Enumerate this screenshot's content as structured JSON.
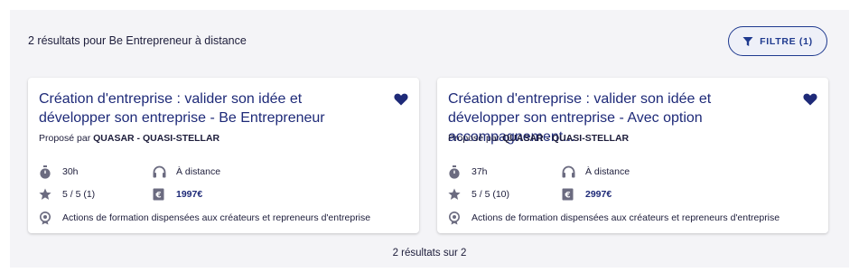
{
  "header": {
    "results_text": "2 résultats pour Be Entrepreneur à distance",
    "filter_label": "FILTRE (1)"
  },
  "cards": [
    {
      "title": "Création d'entreprise : valider son idée et développer son entreprise - Be Entrepreneur",
      "provider_prefix": "Proposé par",
      "provider_name": "QUASAR - QUASI-STELLAR",
      "duration": "30h",
      "mode": "À distance",
      "rating": "5 / 5 (1)",
      "price": "1997€",
      "category": "Actions de formation dispensées aux créateurs et repreneurs d'entreprise"
    },
    {
      "title": "Création d'entreprise : valider son idée et développer son entreprise - Avec option accompagnement...",
      "provider_prefix": "Proposé par",
      "provider_name": "QUASAR - QUASI-STELLAR",
      "duration": "37h",
      "mode": "À distance",
      "rating": "5 / 5 (10)",
      "price": "2997€",
      "category": "Actions de formation dispensées aux créateurs et repreneurs d'entreprise"
    }
  ],
  "footer": {
    "count_text": "2 résultats sur 2"
  },
  "colors": {
    "accent": "#1f3a8f",
    "title": "#1e2a78",
    "panel_bg": "#f4f4f7",
    "icon": "#6b6b80"
  },
  "icons": [
    "filter-icon",
    "heart-icon",
    "stopwatch-icon",
    "headphones-icon",
    "star-icon",
    "euro-icon",
    "award-icon"
  ]
}
